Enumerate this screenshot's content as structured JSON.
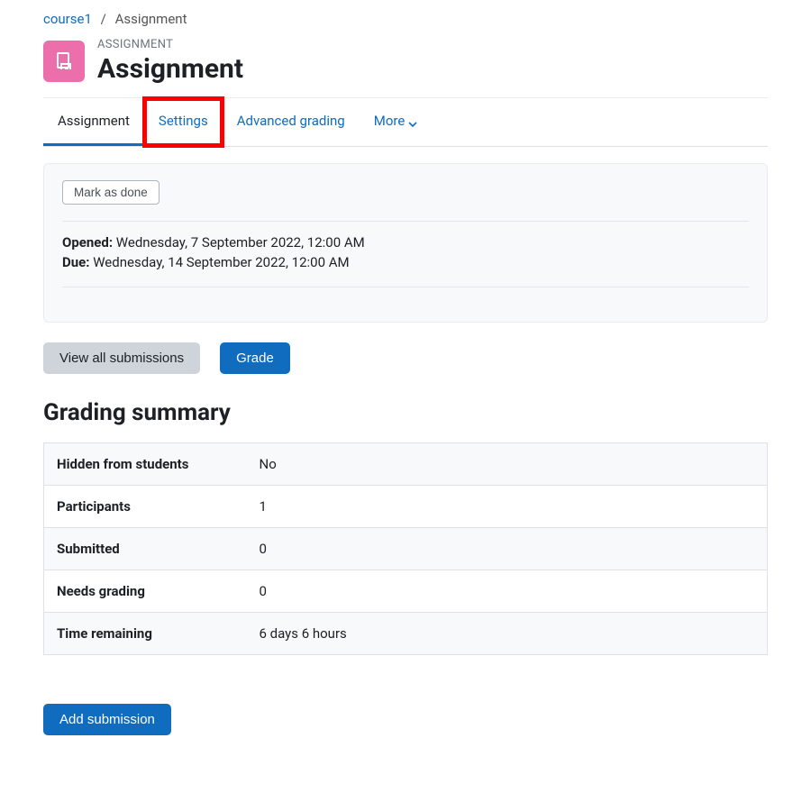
{
  "breadcrumb": {
    "parent": "course1",
    "current": "Assignment"
  },
  "header": {
    "kind": "ASSIGNMENT",
    "title": "Assignment"
  },
  "tabs": {
    "assignment": "Assignment",
    "settings": "Settings",
    "advanced_grading": "Advanced grading",
    "more": "More"
  },
  "info": {
    "mark_done": "Mark as done",
    "opened_label": "Opened:",
    "opened_value": "Wednesday, 7 September 2022, 12:00 AM",
    "due_label": "Due:",
    "due_value": "Wednesday, 14 September 2022, 12:00 AM"
  },
  "actions": {
    "view_all": "View all submissions",
    "grade": "Grade",
    "add_submission": "Add submission"
  },
  "summary": {
    "heading": "Grading summary",
    "rows": [
      {
        "label": "Hidden from students",
        "value": "No"
      },
      {
        "label": "Participants",
        "value": "1"
      },
      {
        "label": "Submitted",
        "value": "0"
      },
      {
        "label": "Needs grading",
        "value": "0"
      },
      {
        "label": "Time remaining",
        "value": "6 days 6 hours"
      }
    ]
  },
  "highlight": {
    "tab": "settings"
  }
}
